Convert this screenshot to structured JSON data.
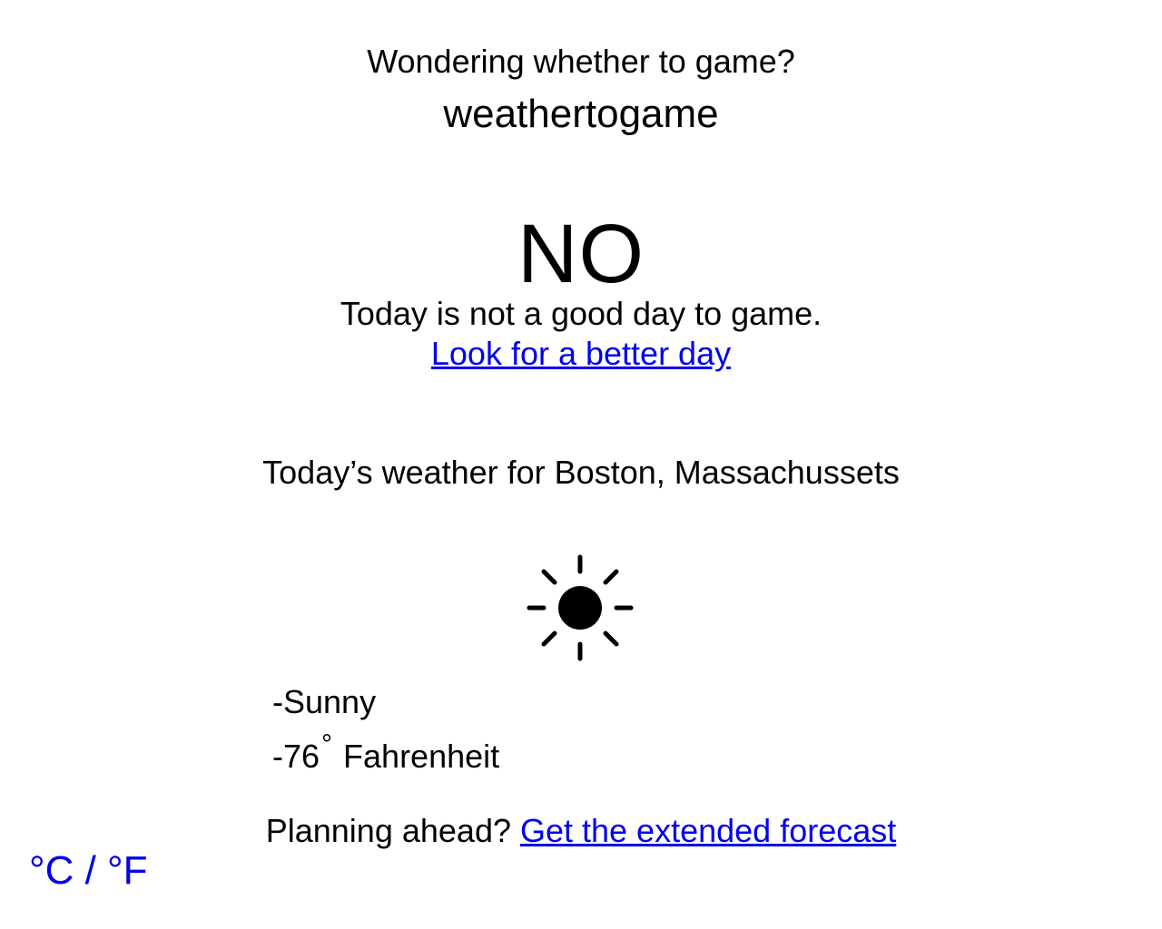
{
  "header": {
    "tagline": "Wondering whether to game?",
    "brand": "weathertogame"
  },
  "verdict": {
    "answer": "NO",
    "message": "Today is not a good day to game.",
    "better_day_link": "Look for a better day"
  },
  "weather": {
    "location_heading": "Today’s weather for Boston, Massachussets",
    "icon": "sun-icon",
    "condition": "-Sunny",
    "temp_prefix": "-76",
    "degree_symbol": "°",
    "temp_unit": " Fahrenheit"
  },
  "footer": {
    "planning_text": "Planning ahead? ",
    "extended_forecast_link": "Get the extended forecast",
    "unit_toggle": "°C / °F"
  },
  "colors": {
    "link": "#0000ee",
    "text": "#000000",
    "background": "#ffffff"
  }
}
